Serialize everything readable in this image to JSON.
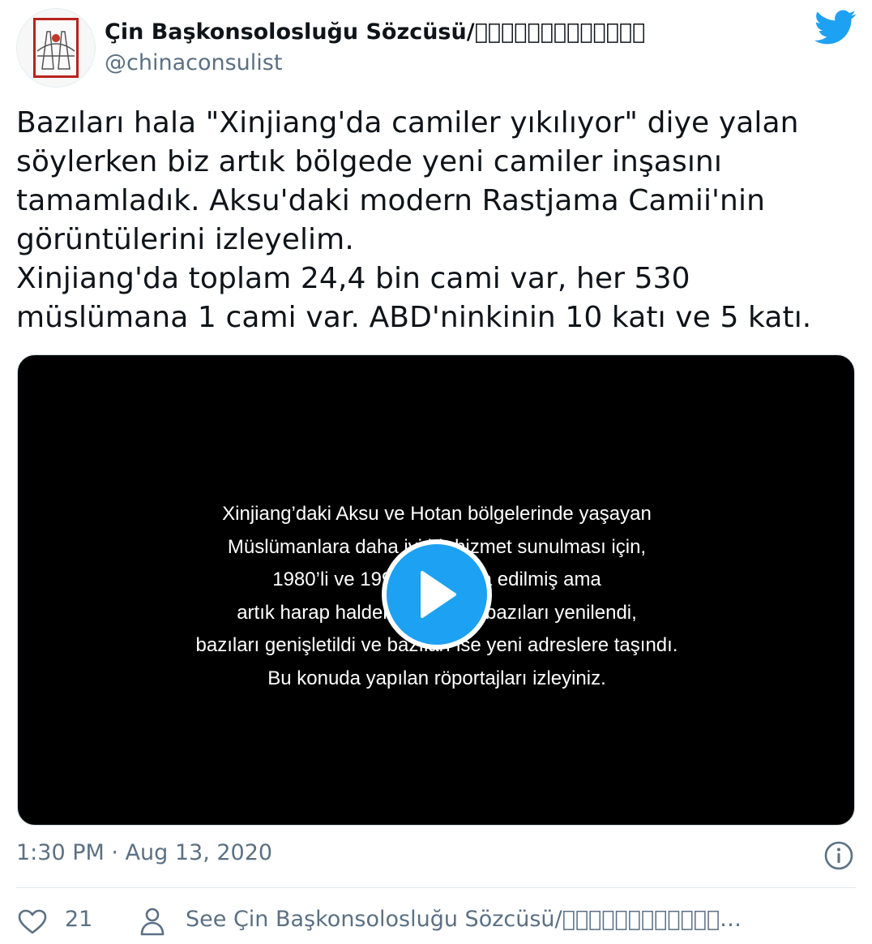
{
  "author": {
    "name": "Çin Başkonsolosluğu Sözcüsü/􏰀􏰁􏰂􏰃􏰄􏰅􏰆􏰇􏰈􏰉􏰊􏰋􏰌",
    "handle": "@chinaconsulist",
    "avatar_icon": "consulate-logo-avatar"
  },
  "brand": {
    "logo": "twitter-bird-icon",
    "color": "#1da1f2"
  },
  "tweet": {
    "text": "Bazıları hala \"Xinjiang'da camiler yıkılıyor\" diye yalan\nsöylerken biz artık bölgede yeni camiler inşasını\ntamamladık. Aksu'daki modern Rastjama Camii'nin\ngörüntülerini izleyelim.\nXinjiang'da toplam 24,4 bin cami var, her 530\nmüslümana 1 cami var. ABD'ninkinin 10 katı ve 5 katı."
  },
  "video": {
    "caption_lines": [
      "Xinjiang’daki Aksu ve Hotan bölgelerinde yaşayan",
      "Müslümanlara daha iyi bir hizmet sunulması için,",
      "1980’li ve 1990’larda inşa edilmiş ama",
      "artık harap haldeki camilerin bazıları yenilendi,",
      "bazıları genişletildi ve bazıları ise yeni adreslere taşındı.",
      "Bu konuda yapılan röportajları izleyiniz."
    ],
    "play_icon": "play-icon"
  },
  "meta": {
    "timestamp": "1:30 PM · Aug 13, 2020",
    "info_icon": "info-icon"
  },
  "actions": {
    "like_count": "21",
    "see_profile": "See Çin Başkonsolosluğu Sözcüsü/􏰀􏰁􏰂􏰃􏰄􏰅􏰆􏰇􏰈􏰉􏰊􏰋…"
  }
}
